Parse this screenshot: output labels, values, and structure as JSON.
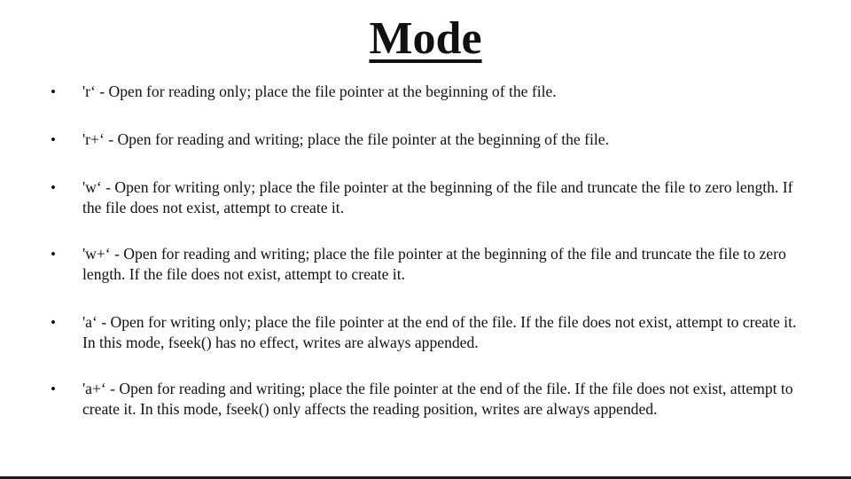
{
  "slide": {
    "title": "Mode",
    "bullet_symbol": "•",
    "items": [
      {
        "text": "'r‘ - Open for reading only; place the file pointer at the beginning of the file."
      },
      {
        "text": "'r+‘ - Open for reading and writing; place the file pointer at the beginning of the file."
      },
      {
        "text": "'w‘ - Open for writing only; place the file pointer at the beginning of the file and truncate the file to zero length. If the file does not exist, attempt to create it."
      },
      {
        "text": "'w+‘ - Open for reading and writing; place the file pointer at the beginning of the file and truncate the file to zero length. If the file does not exist, attempt to create it."
      },
      {
        "text": "'a‘ - Open for writing only; place the file pointer at the end of the file. If the file does not exist, attempt to create it. In this mode, fseek() has no effect, writes are always appended."
      },
      {
        "text": "'a+‘ - Open for reading and writing; place the file pointer at the end of the file. If the file does not exist, attempt to create it. In this mode, fseek() only affects the reading position, writes are always appended."
      }
    ]
  }
}
